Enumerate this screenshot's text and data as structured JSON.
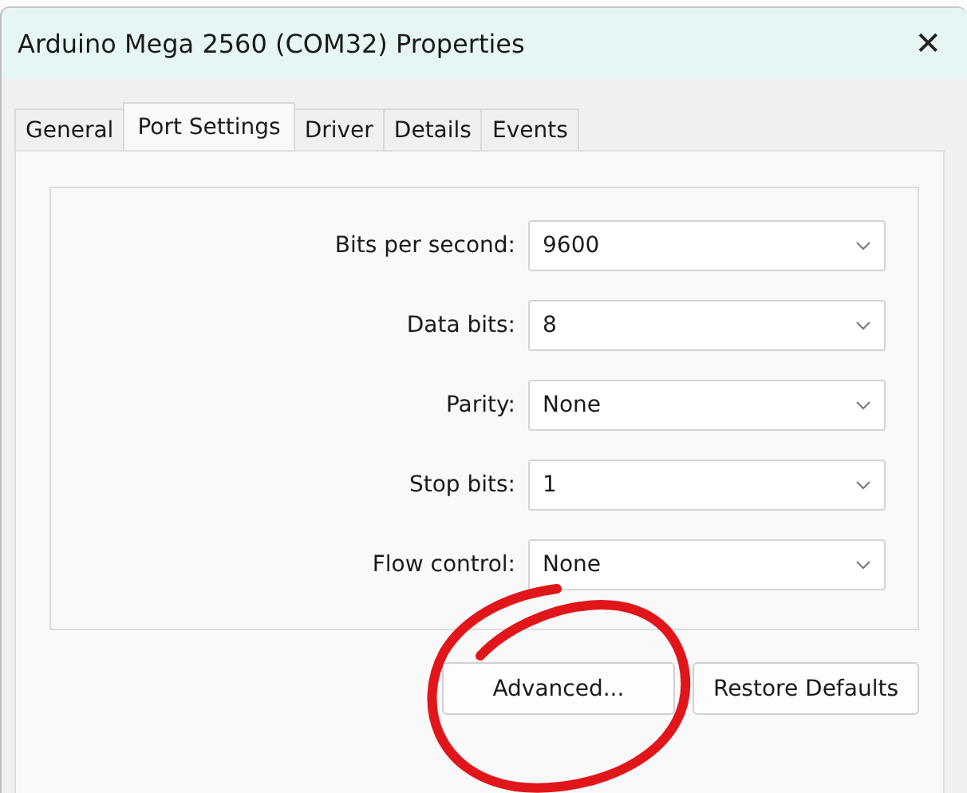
{
  "window": {
    "title": "Arduino Mega 2560 (COM32) Properties",
    "close": "✕"
  },
  "tabs": [
    {
      "label": "General",
      "selected": false
    },
    {
      "label": "Port Settings",
      "selected": true
    },
    {
      "label": "Driver",
      "selected": false
    },
    {
      "label": "Details",
      "selected": false
    },
    {
      "label": "Events",
      "selected": false
    }
  ],
  "settings": [
    {
      "label": "Bits per second:",
      "value": "9600"
    },
    {
      "label": "Data bits:",
      "value": "8"
    },
    {
      "label": "Parity:",
      "value": "None"
    },
    {
      "label": "Stop bits:",
      "value": "1"
    },
    {
      "label": "Flow control:",
      "value": "None"
    }
  ],
  "buttons": [
    "Advanced...",
    "Restore Defaults"
  ]
}
